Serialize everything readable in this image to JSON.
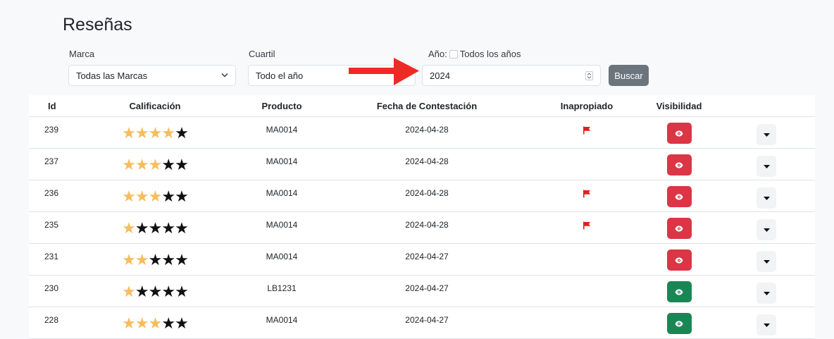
{
  "page": {
    "title": "Reseñas"
  },
  "filters": {
    "marca": {
      "label": "Marca",
      "value": "Todas las Marcas"
    },
    "cuartil": {
      "label": "Cuartil",
      "value": "Todo el año"
    },
    "anio": {
      "label": "Año:",
      "all_years_label": "Todos los años",
      "all_years_checked": false,
      "value": "2024"
    },
    "search_button": "Buscar"
  },
  "table": {
    "headers": {
      "id": "Id",
      "rating": "Calificación",
      "product": "Producto",
      "date": "Fecha de Contestación",
      "inappropriate": "Inapropiado",
      "visibility": "Visibilidad"
    },
    "rows": [
      {
        "id": "239",
        "rating": 4,
        "product": "MA0014",
        "date": "2024-04-28",
        "inappropriate": true,
        "visible": false
      },
      {
        "id": "237",
        "rating": 3,
        "product": "MA0014",
        "date": "2024-04-28",
        "inappropriate": false,
        "visible": false
      },
      {
        "id": "236",
        "rating": 3,
        "product": "MA0014",
        "date": "2024-04-28",
        "inappropriate": true,
        "visible": false
      },
      {
        "id": "235",
        "rating": 1,
        "product": "MA0014",
        "date": "2024-04-28",
        "inappropriate": true,
        "visible": false
      },
      {
        "id": "231",
        "rating": 2,
        "product": "MA0014",
        "date": "2024-04-27",
        "inappropriate": false,
        "visible": false
      },
      {
        "id": "230",
        "rating": 1,
        "product": "LB1231",
        "date": "2024-04-27",
        "inappropriate": false,
        "visible": true
      },
      {
        "id": "228",
        "rating": 3,
        "product": "MA0014",
        "date": "2024-04-27",
        "inappropriate": false,
        "visible": true
      }
    ]
  },
  "colors": {
    "star_filled": "#f6bd5d",
    "star_empty": "#111111",
    "visibility_hidden": "#dc3545",
    "visibility_shown": "#198754",
    "flag": "#e0201a",
    "annotation_arrow": "#ee2a24"
  },
  "icons": {
    "flag": "flag-icon",
    "visibility": "eye-icon",
    "dropdown": "caret-down-icon",
    "select": "chevron-down-icon"
  }
}
